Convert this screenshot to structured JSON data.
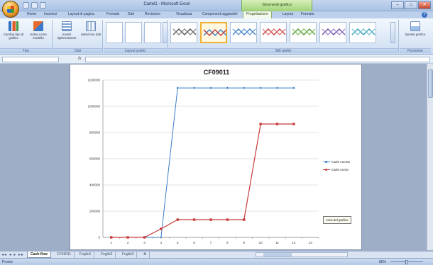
{
  "window": {
    "title": "Cartel1 - Microsoft Excel",
    "context_group": "Strumenti grafico"
  },
  "ribbon": {
    "tabs": [
      {
        "label": "Home",
        "key": "H"
      },
      {
        "label": "Inserisci",
        "key": "N"
      },
      {
        "label": "Layout di pagina",
        "key": "P"
      },
      {
        "label": "Formule",
        "key": "M"
      },
      {
        "label": "Dati",
        "key": "A"
      },
      {
        "label": "Revisione",
        "key": "R"
      },
      {
        "label": "Visualizza",
        "key": "W"
      },
      {
        "label": "Componenti aggiuntivi",
        "key": "X"
      },
      {
        "label": "Progettazione",
        "key": "JC"
      },
      {
        "label": "Layout",
        "key": "JA"
      },
      {
        "label": "Formato",
        "key": "JO"
      }
    ],
    "groups": {
      "tipo": {
        "label": "Tipo",
        "buttons": [
          "Cambia tipo di grafico",
          "Salva come modello"
        ]
      },
      "dati": {
        "label": "Dati",
        "buttons": [
          "Inverti righe/colonne",
          "Seleziona dati"
        ]
      },
      "layout": {
        "label": "Layout grafici"
      },
      "stili": {
        "label": "Stili grafici"
      },
      "posizione": {
        "label": "Posizione",
        "buttons": [
          "Sposta grafico"
        ]
      }
    }
  },
  "formula_bar": {
    "fx": "fx",
    "name_box": ""
  },
  "chart_data": {
    "type": "line",
    "title": "CF09011",
    "categories": [
      "1",
      "2",
      "3",
      "4",
      "5",
      "6",
      "7",
      "8",
      "9",
      "10",
      "11",
      "12",
      "13"
    ],
    "y_ticks": [
      "0",
      "200000",
      "400000",
      "600000",
      "800000",
      "1000000",
      "1200000"
    ],
    "ylim": [
      0,
      1200000
    ],
    "series": [
      {
        "name": "totale entrate",
        "color": "#3a7cc9",
        "values": [
          0,
          0,
          0,
          0,
          1140000,
          1140000,
          1140000,
          1140000,
          1140000,
          1140000,
          1140000,
          1140000
        ]
      },
      {
        "name": "totale uscite",
        "color": "#c83b3b",
        "values": [
          0,
          0,
          0,
          65000,
          135000,
          135000,
          135000,
          135000,
          135000,
          865000,
          865000,
          865000
        ]
      }
    ],
    "legend_position": "right",
    "grid": true
  },
  "tooltip": "Area del grafico",
  "sheets": [
    "Cash-flow",
    "CF09011",
    "Foglio1",
    "Foglio2",
    "Foglio3"
  ],
  "status": {
    "left": "Pronto",
    "zoom": "85%"
  },
  "colors": {
    "ribbon_bg": "#dbe7f6",
    "context_tab": "#9fd37a"
  }
}
